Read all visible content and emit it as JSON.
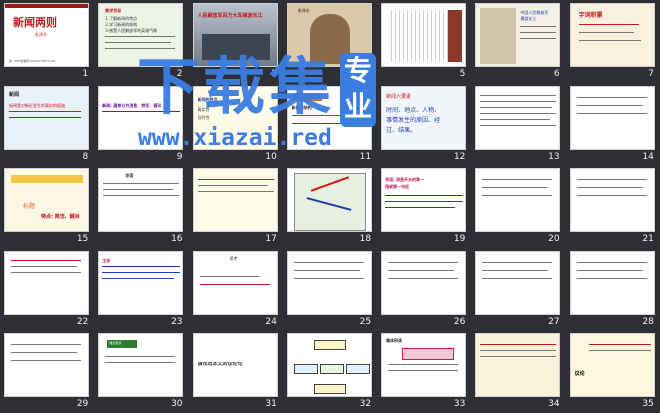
{
  "watermark": {
    "title": "下载集",
    "badge": "专业",
    "url": "www.xiazai.red"
  },
  "slides": [
    {
      "n": "1",
      "texts": [
        "新闻两则",
        "毛泽东",
        "第一PPT模板网-WWW.1PPT.COM"
      ]
    },
    {
      "n": "2",
      "texts": [
        "教学目标",
        "1.了解新闻的特点",
        "2.学习新闻的结构",
        "3.感受人民解放军的英雄气概"
      ]
    },
    {
      "n": "3",
      "texts": [
        "人民解放军百万大军横渡长江"
      ]
    },
    {
      "n": "4",
      "texts": [
        "毛泽东"
      ]
    },
    {
      "n": "5",
      "texts": []
    },
    {
      "n": "6",
      "texts": [
        "中国人民解放军",
        "横渡长江"
      ]
    },
    {
      "n": "7",
      "texts": [
        "字词积累"
      ]
    },
    {
      "n": "8",
      "texts": [
        "新闻",
        "新闻是对新近发生的事实的报道"
      ]
    },
    {
      "n": "9",
      "texts": [
        "新闻: 通常分为消息、特写、通讯"
      ]
    },
    {
      "n": "10",
      "texts": [
        "新闻的特点",
        "真实性",
        "及时性"
      ]
    },
    {
      "n": "11",
      "texts": [
        "新闻的结构"
      ]
    },
    {
      "n": "12",
      "texts": [
        "新闻六要素",
        "时间、地点、人物、",
        "事情发生的原因、经",
        "过、结果。"
      ]
    },
    {
      "n": "13",
      "texts": []
    },
    {
      "n": "14",
      "texts": []
    },
    {
      "n": "15",
      "texts": [
        "标题",
        "特点: 简洁、醒目"
      ]
    },
    {
      "n": "16",
      "texts": [
        "导语"
      ]
    },
    {
      "n": "17",
      "texts": []
    },
    {
      "n": "18",
      "texts": []
    },
    {
      "n": "19",
      "texts": [
        "导语: 消息开头的第一",
        "段或第一句话"
      ]
    },
    {
      "n": "20",
      "texts": []
    },
    {
      "n": "21",
      "texts": []
    },
    {
      "n": "22",
      "texts": []
    },
    {
      "n": "23",
      "texts": [
        "主体"
      ]
    },
    {
      "n": "24",
      "texts": [
        "思考"
      ]
    },
    {
      "n": "25",
      "texts": []
    },
    {
      "n": "26",
      "texts": []
    },
    {
      "n": "27",
      "texts": []
    },
    {
      "n": "28",
      "texts": []
    },
    {
      "n": "29",
      "texts": []
    },
    {
      "n": "30",
      "texts": [
        "课文研读"
      ]
    },
    {
      "n": "31",
      "texts": [
        "请找出本文的议论句"
      ]
    },
    {
      "n": "32",
      "texts": []
    },
    {
      "n": "33",
      "texts": [
        "集体研读"
      ]
    },
    {
      "n": "34",
      "texts": []
    },
    {
      "n": "35",
      "texts": [
        "议论"
      ]
    }
  ]
}
